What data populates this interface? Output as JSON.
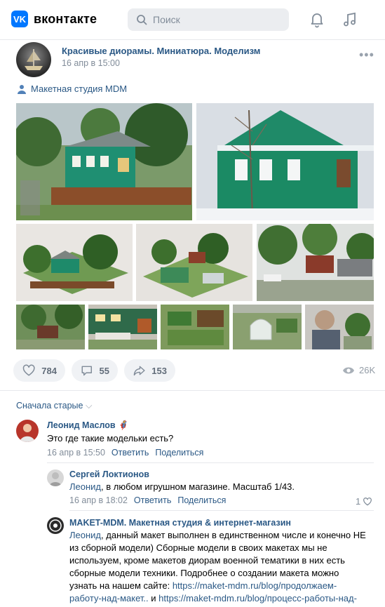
{
  "header": {
    "logo_letters": "VK",
    "logo_text": "вконтакте",
    "search_placeholder": "Поиск",
    "icons": [
      "search-icon",
      "bell-icon",
      "music-icon"
    ]
  },
  "post": {
    "group_name": "Красивые диорамы. Миниатюра. Моделизм",
    "date": "16 апр в 15:00",
    "author": "Макетная студия MDM",
    "photos_count": 10,
    "likes": "784",
    "comments": "55",
    "shares": "153",
    "views": "26K"
  },
  "comments": {
    "sort_label": "Сначала старые",
    "items": [
      {
        "author": "Леонид Маслов",
        "text": "Это где такие модельки есть?",
        "date": "16 апр в 15:50",
        "reply": "Ответить",
        "share": "Поделиться"
      },
      {
        "author": "Сергей Локтионов",
        "mention": "Леонид",
        "text": ", в любом игрушном магазине. Масштаб 1/43.",
        "date": "16 апр в 18:02",
        "reply": "Ответить",
        "share": "Поделиться",
        "likes": "1"
      },
      {
        "author": "MAKET-MDM. Макетная студия & интернет-магазин",
        "mention": "Леонид",
        "text_line1": ", данный макет выполнен в единственном числе и конечно НЕ",
        "text_line2": "из сборной модели) Сборные модели в своих макетах мы не",
        "text_line3": "используем, кроме макетов диорам военной тематики в них есть",
        "text_line4": "сборные модели техники. Подробнее о создании макета можно",
        "text_line5_prefix": "узнать на нашем сайте: ",
        "link1_a": "https://maket-mdm.ru/blog/продолжаем-",
        "link1_b": "работу-над-макет..",
        "and": " и ",
        "link2": "https://maket-mdm.ru/blog/процесс-работы-над-"
      }
    ]
  },
  "colors": {
    "brand": "#0077ff",
    "link": "#2a5885",
    "muted": "#818c99",
    "page_bg": "#edeef0"
  }
}
